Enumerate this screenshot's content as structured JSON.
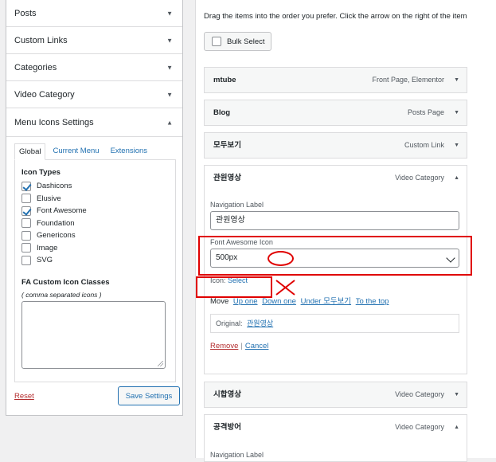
{
  "left": {
    "sections": [
      {
        "label": "Posts"
      },
      {
        "label": "Custom Links"
      },
      {
        "label": "Categories"
      },
      {
        "label": "Video Category"
      },
      {
        "label": "Menu Icons Settings"
      }
    ],
    "tabs": [
      "Global",
      "Current Menu",
      "Extensions"
    ],
    "icon_types_heading": "Icon Types",
    "icon_types": [
      {
        "label": "Dashicons",
        "checked": true
      },
      {
        "label": "Elusive",
        "checked": false
      },
      {
        "label": "Font Awesome",
        "checked": true
      },
      {
        "label": "Foundation",
        "checked": false
      },
      {
        "label": "Genericons",
        "checked": false
      },
      {
        "label": "Image",
        "checked": false
      },
      {
        "label": "SVG",
        "checked": false
      }
    ],
    "fa_heading": "FA Custom Icon Classes",
    "fa_note": "( comma separated icons )",
    "reset": "Reset",
    "save": "Save Settings"
  },
  "right": {
    "instructions": "Drag the items into the order you prefer. Click the arrow on the right of the item",
    "bulk_select": "Bulk Select",
    "items": [
      {
        "title": "mtube",
        "type": "Front Page, Elementor"
      },
      {
        "title": "Blog",
        "type": "Posts Page"
      },
      {
        "title": "모두보기",
        "type": "Custom Link"
      },
      {
        "title": "관원영상",
        "type": "Video Category"
      },
      {
        "title": "시합영상",
        "type": "Video Category"
      },
      {
        "title": "공격방어",
        "type": "Video Category"
      }
    ],
    "open_item": {
      "nav_label_caption": "Navigation Label",
      "nav_label_value": "관원영상",
      "fa_icon_caption": "Font Awesome Icon",
      "fa_icon_value": "500px",
      "icon_caption": "Icon:",
      "icon_select": "Select",
      "move_caption": "Move",
      "move_links": [
        "Up one",
        "Down one",
        "Under 모두보기",
        "To the top"
      ],
      "original_caption": "Original:",
      "original_value": "관원영상",
      "remove": "Remove",
      "separator": "|",
      "cancel": "Cancel"
    },
    "last_item_nav_label": "Navigation Label"
  },
  "colors": {
    "accent": "#2271b1",
    "danger": "#b32d2e",
    "annotation": "#e00000"
  }
}
